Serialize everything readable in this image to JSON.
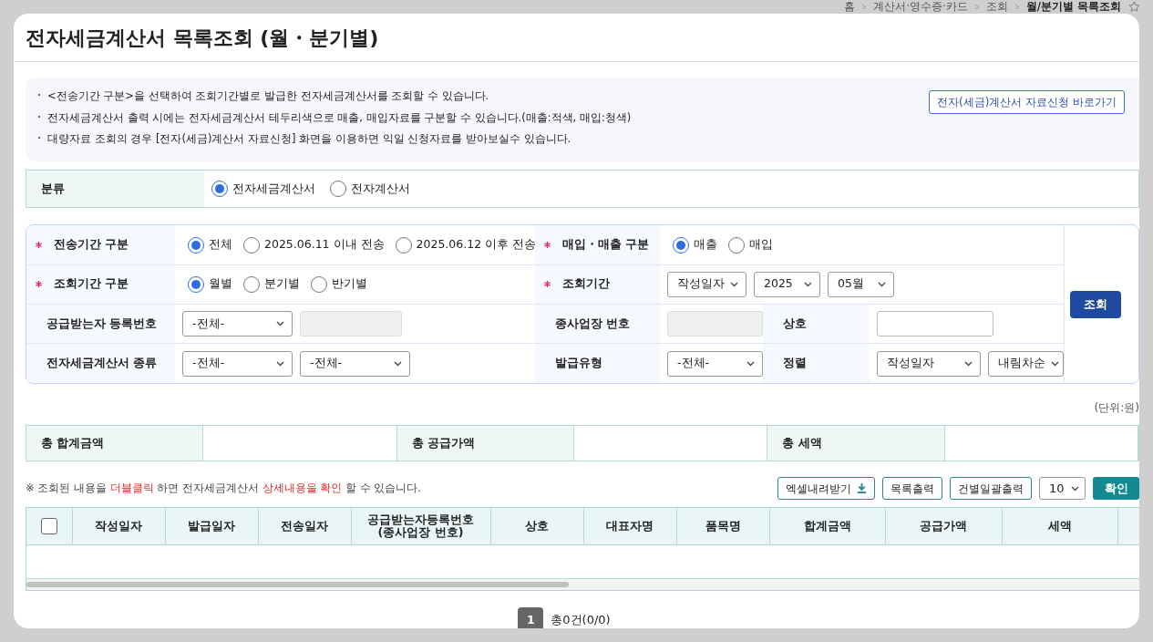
{
  "breadcrumb": [
    {
      "label": "홈",
      "current": false
    },
    {
      "label": "계산서·영수증·카드",
      "current": false
    },
    {
      "label": "조회",
      "current": false
    },
    {
      "label": "월/분기별 목록조회",
      "current": true
    }
  ],
  "favorite": {
    "on": false
  },
  "title": "전자세금계산서 목록조회 (월・분기별)",
  "notices": [
    "<전송기간 구분>을 선택하여 조회기간별로 발급한 전자세금계산서를 조회할 수 있습니다.",
    "전자세금계산서 출력 시에는 전자세금계산서 테두리색으로 매출, 매입자료를 구분할 수 있습니다.(매출:적색, 매입:청색)",
    "대량자료 조회의 경우 [전자(세금)계산서 자료신청] 화면을 이용하면 익일 신청자료를 받아보실수 있습니다."
  ],
  "notice_link": "전자(세금)계산서 자료신청 바로가기",
  "category": {
    "label": "분류",
    "options": [
      {
        "label": "전자세금계산서",
        "selected": true
      },
      {
        "label": "전자계산서",
        "selected": false
      }
    ]
  },
  "search": {
    "rows": [
      [
        {
          "kind": "label",
          "text": "전송기간 구분",
          "required": true
        },
        {
          "kind": "radios",
          "options": [
            {
              "label": "전체",
              "selected": true
            },
            {
              "label": "2025.06.11 이내 전송",
              "selected": false
            },
            {
              "label": "2025.06.12 이후 전송",
              "selected": false
            }
          ]
        },
        {
          "kind": "label",
          "text": "매입・매출 구분",
          "required": true
        },
        {
          "kind": "radios",
          "options": [
            {
              "label": "매출",
              "selected": true
            },
            {
              "label": "매입",
              "selected": false
            }
          ]
        }
      ],
      [
        {
          "kind": "label",
          "text": "조회기간 구분",
          "required": true
        },
        {
          "kind": "radios",
          "options": [
            {
              "label": "월별",
              "selected": true
            },
            {
              "label": "분기별",
              "selected": false
            },
            {
              "label": "반기별",
              "selected": false
            }
          ]
        },
        {
          "kind": "label",
          "text": "조회기간",
          "required": true
        },
        {
          "kind": "selects",
          "items": [
            {
              "value": "작성일자"
            },
            {
              "value": "2025"
            },
            {
              "value": "05월"
            }
          ]
        }
      ],
      [
        {
          "kind": "label",
          "text": "공급받는자 등록번호",
          "required": false
        },
        {
          "kind": "selects",
          "items": [
            {
              "value": "-전체-"
            },
            {
              "kind": "input",
              "disabled": true
            }
          ]
        },
        {
          "kind": "label",
          "text": "종사업장 번호",
          "required": false
        },
        {
          "kind": "selects",
          "items": [
            {
              "kind": "input",
              "disabled": true
            }
          ]
        },
        {
          "kind": "label",
          "text": "상호",
          "required": false
        },
        {
          "kind": "selects",
          "items": [
            {
              "kind": "input",
              "disabled": false
            }
          ]
        }
      ],
      [
        {
          "kind": "label",
          "text": "전자세금계산서 종류",
          "required": false
        },
        {
          "kind": "selects",
          "items": [
            {
              "value": "-전체-"
            },
            {
              "value": "-전체-"
            }
          ]
        },
        {
          "kind": "label",
          "text": "발급유형",
          "required": false
        },
        {
          "kind": "selects",
          "items": [
            {
              "value": "-전체-"
            }
          ]
        },
        {
          "kind": "label",
          "text": "정렬",
          "required": false
        },
        {
          "kind": "selects",
          "items": [
            {
              "value": "작성일자"
            },
            {
              "value": "내림차순"
            }
          ]
        }
      ]
    ],
    "button": "조회"
  },
  "unit": "(단위:원)",
  "totals": [
    {
      "label": "총 합계금액"
    },
    {
      "label": "총 공급가액"
    },
    {
      "label": "총 세액"
    }
  ],
  "note": [
    {
      "text": "※ 조회된 내용을 ",
      "highlight": false
    },
    {
      "text": "더블클릭",
      "highlight": true
    },
    {
      "text": " 하면 전자세금계산서 ",
      "highlight": false
    },
    {
      "text": "상세내용을 확인",
      "highlight": true
    },
    {
      "text": " 할 수 있습니다.",
      "highlight": false
    }
  ],
  "toolbar": [
    {
      "kind": "download",
      "label": "엑셀내려받기"
    },
    {
      "kind": "outline",
      "label": "목록출력"
    },
    {
      "kind": "outline",
      "label": "건별일괄출력"
    },
    {
      "kind": "select",
      "label": "10"
    },
    {
      "kind": "primary",
      "label": "확인"
    }
  ],
  "table": {
    "select_all": {
      "checked": false
    },
    "columns": [
      "작성일자",
      "발급일자",
      "전송일자",
      "공급받는자등록번호\n(종사업장 번호)",
      "상호",
      "대표자명",
      "품목명",
      "합계금액",
      "공급가액",
      "세액"
    ]
  },
  "pagination": {
    "pages": [
      {
        "label": "1",
        "selected": true
      }
    ],
    "summary": "총0건(0/0)"
  }
}
